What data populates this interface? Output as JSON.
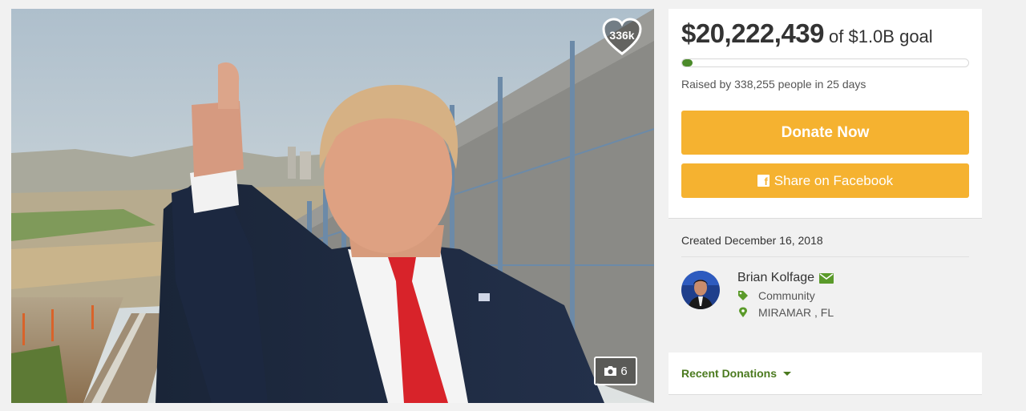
{
  "hero": {
    "likes": "336k",
    "photo_count": "6"
  },
  "fundraiser": {
    "amount_raised": "$20,222,439",
    "goal_text": "of $1.0B goal",
    "progress_percent": 2,
    "raised_text": "Raised by 338,255 people in 25 days",
    "donate_label": "Donate Now",
    "share_label": "Share on Facebook"
  },
  "info": {
    "created_text": "Created December 16, 2018",
    "organizer_name": "Brian Kolfage",
    "category": "Community",
    "location": "MIRAMAR , FL"
  },
  "recent": {
    "label": "Recent Donations"
  },
  "colors": {
    "accent": "#f5b230",
    "green": "#4b7a1f",
    "progress": "#4b8a2a"
  },
  "icons": {
    "heart": "heart-icon",
    "camera": "camera-icon",
    "facebook": "facebook-icon",
    "mail": "envelope-icon",
    "tag": "tag-icon",
    "location": "map-marker-icon",
    "caret": "caret-down-icon"
  }
}
